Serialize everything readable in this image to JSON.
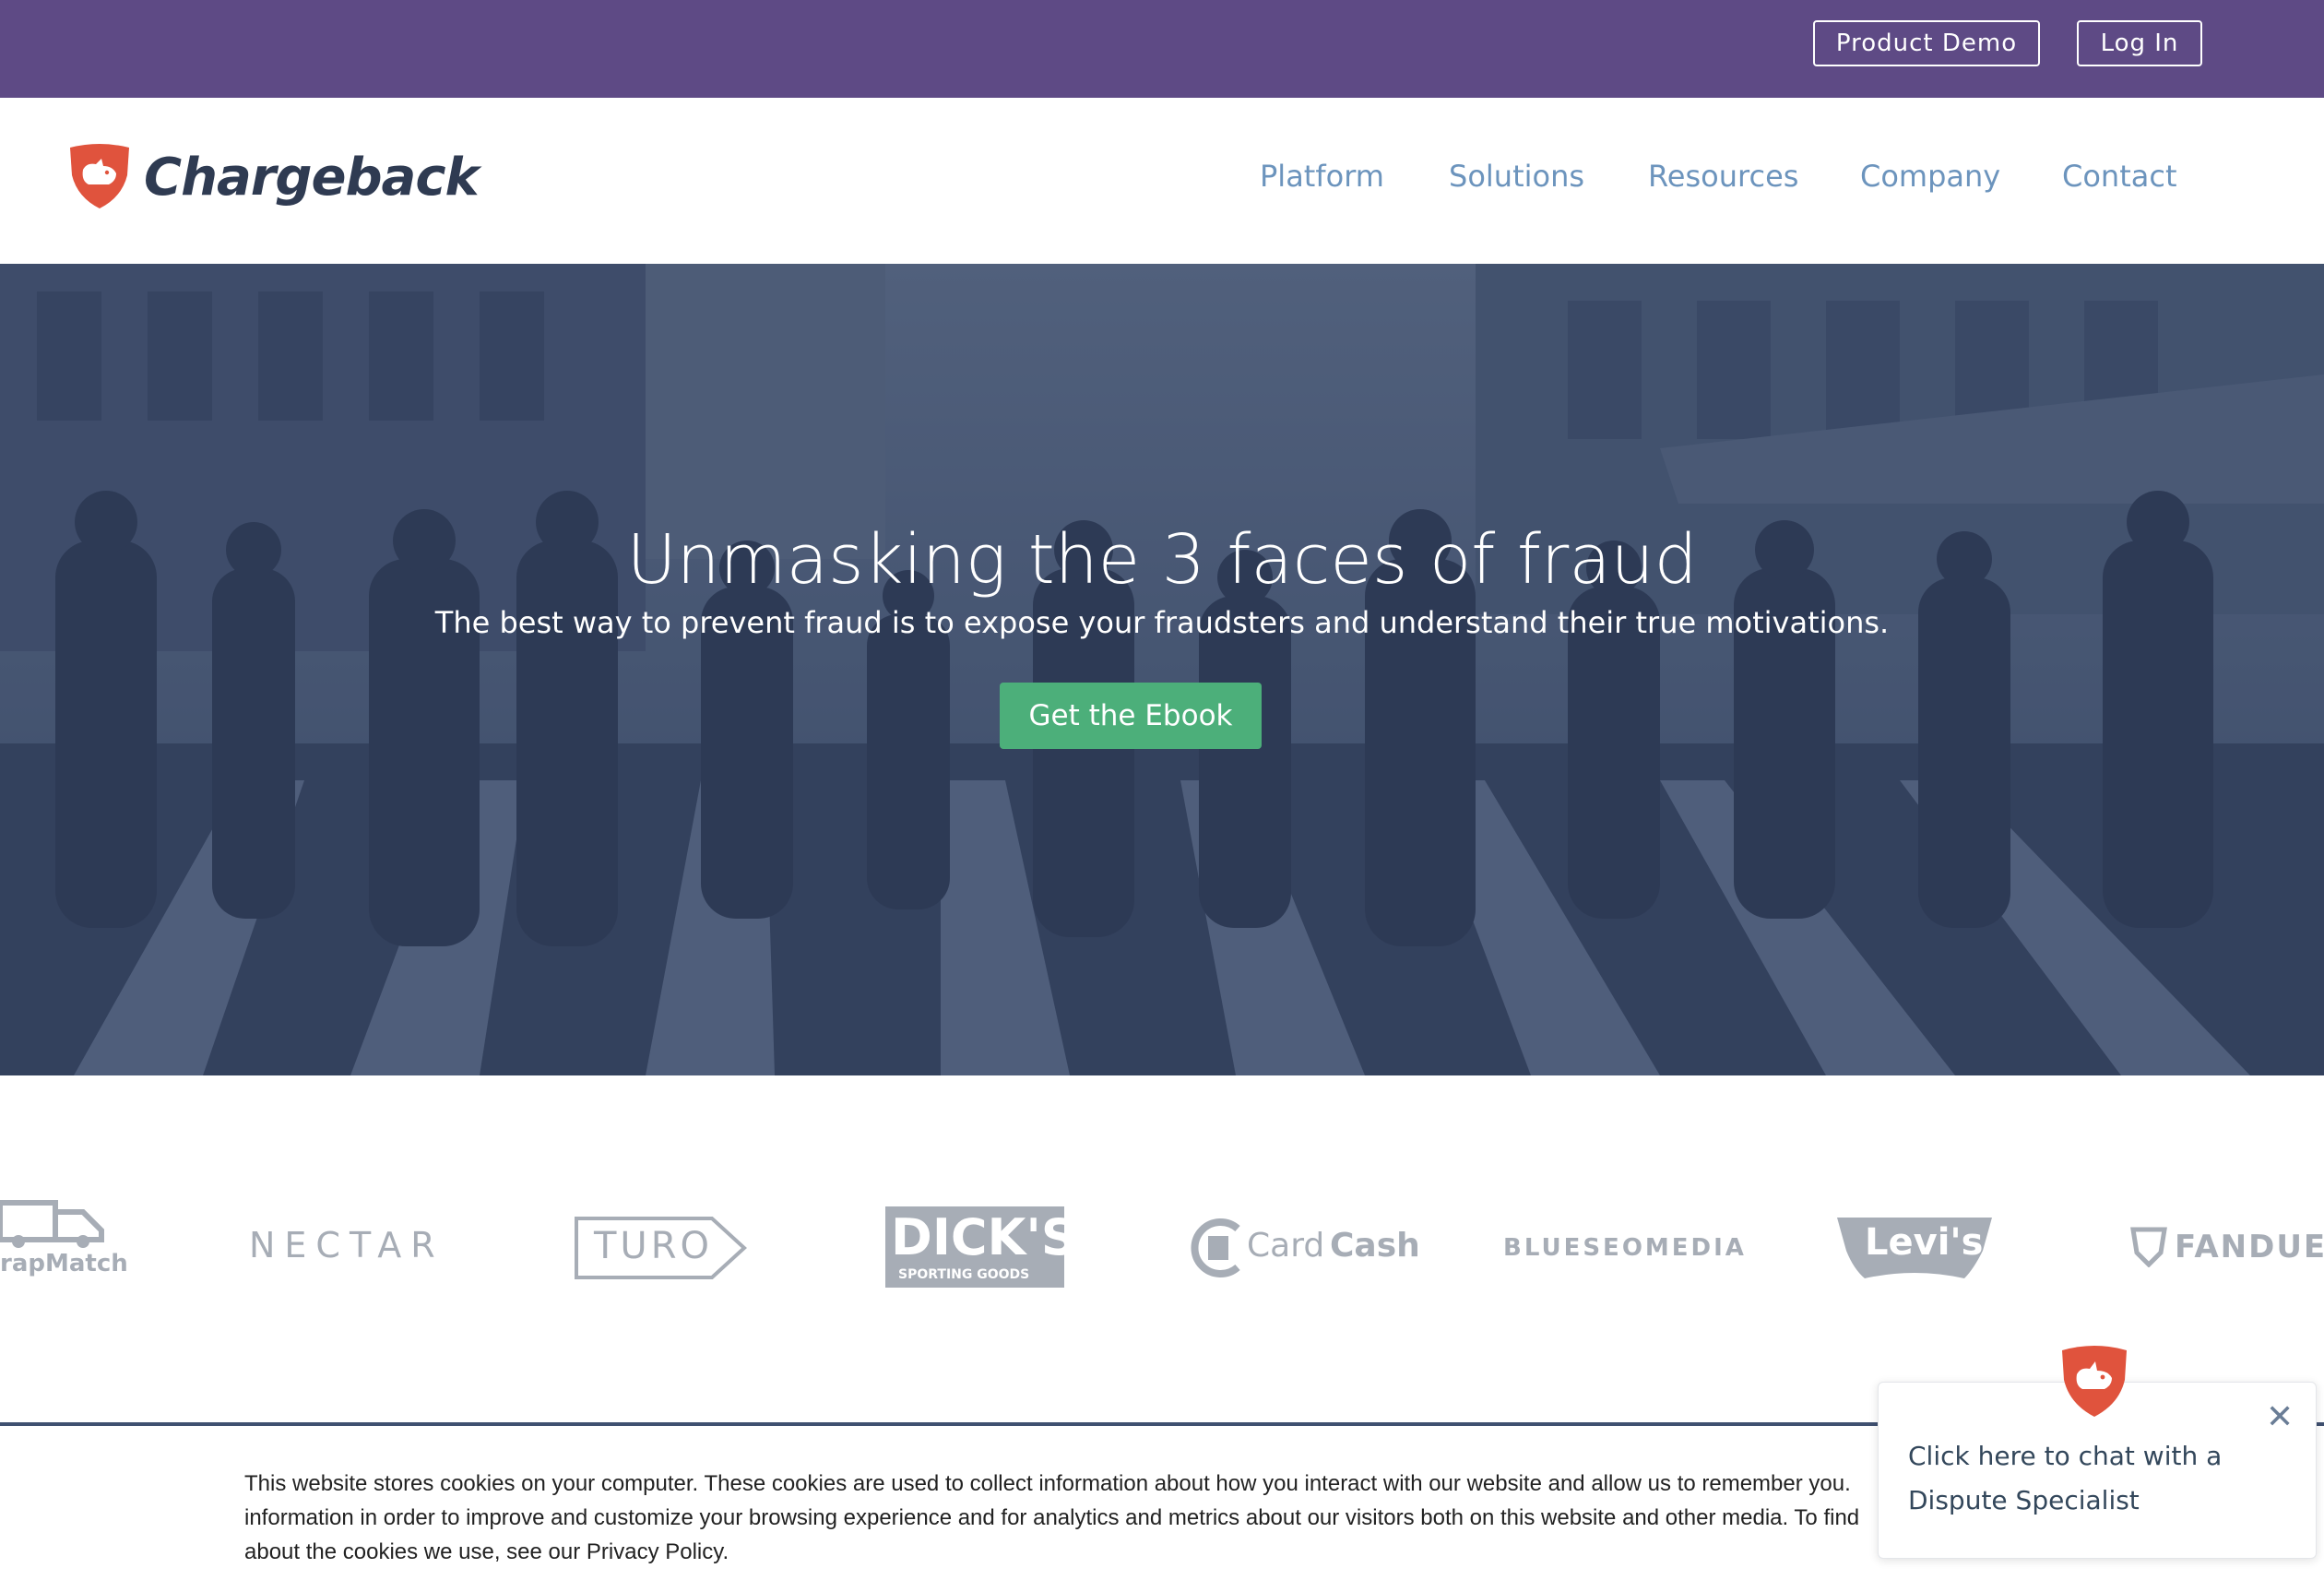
{
  "topbar": {
    "demo_label": "Product Demo",
    "login_label": "Log In"
  },
  "brand": {
    "name": "Chargeback",
    "logo_icon": "rhino-shield-icon"
  },
  "nav": {
    "items": [
      {
        "label": "Platform"
      },
      {
        "label": "Solutions"
      },
      {
        "label": "Resources"
      },
      {
        "label": "Company"
      },
      {
        "label": "Contact"
      }
    ]
  },
  "hero": {
    "title": "Unmasking the 3 faces of fraud",
    "subtitle": "The best way to prevent fraud is to expose your fraudsters and understand their true motivations.",
    "cta_label": "Get the Ebook"
  },
  "client_logos": [
    {
      "name": "TrapMatch",
      "text": "rapMatch"
    },
    {
      "name": "Nectar",
      "text": "NECTAR"
    },
    {
      "name": "Turo",
      "text": "TURO"
    },
    {
      "name": "Dick's Sporting Goods",
      "text": "DICK'S",
      "subtext": "SPORTING GOODS"
    },
    {
      "name": "CardCash",
      "text_a": "Card",
      "text_b": "Cash"
    },
    {
      "name": "Blueseo Media",
      "text": "BLUESEOMEDIA"
    },
    {
      "name": "Levi's",
      "text": "Levi's"
    },
    {
      "name": "FanDuel",
      "text": "FANDUEL"
    }
  ],
  "cookie_banner": {
    "text_1": "This website stores cookies on your computer. These cookies are used to collect information about how you interact with our website and allow us to remember you.",
    "text_2": "information in order to improve and customize your browsing experience and for analytics and metrics about our visitors both on this website and other media. To find",
    "text_3": "about the cookies we use, see our Privacy Policy."
  },
  "chat_widget": {
    "message": "Click here to chat with a Dispute Specialist",
    "close_icon": "close-icon"
  },
  "colors": {
    "topbar": "#5e4a85",
    "nav_link": "#6c94bd",
    "cta": "#4caf7a",
    "brand_red": "#e0533d",
    "brand_dark": "#2f3b52"
  }
}
